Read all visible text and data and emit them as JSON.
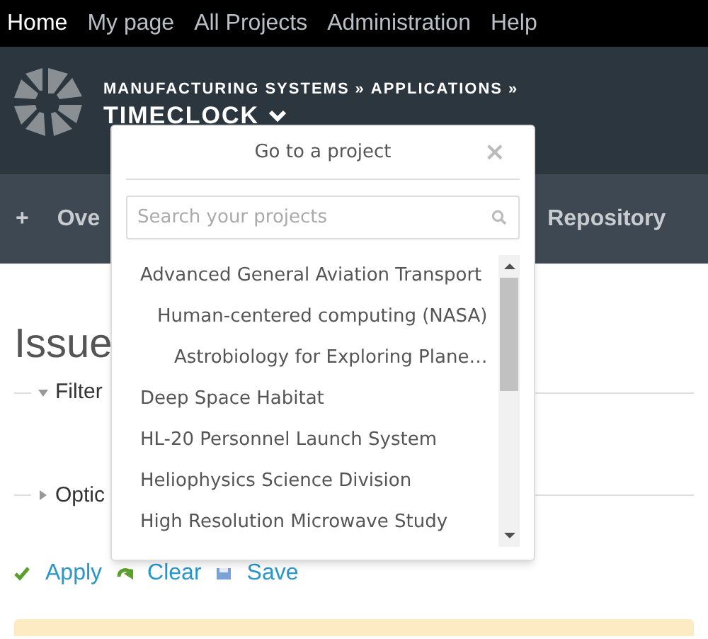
{
  "top_menu": [
    {
      "label": "Home",
      "selected": true
    },
    {
      "label": "My page",
      "selected": false
    },
    {
      "label": "All Projects",
      "selected": false
    },
    {
      "label": "Administration",
      "selected": false
    },
    {
      "label": "Help",
      "selected": false
    }
  ],
  "header": {
    "breadcrumb": [
      "MANUFACTURING SYSTEMS",
      "»",
      "APPLICATIONS",
      "»"
    ],
    "project": "TIMECLOCK"
  },
  "main_menu": [
    {
      "label": "+"
    },
    {
      "label": "Ove"
    },
    {
      "label": "Repository"
    }
  ],
  "content": {
    "title": "Issue",
    "fieldsets": [
      {
        "label": "Filter",
        "expanded": true
      },
      {
        "label": "Optic",
        "expanded": false
      }
    ],
    "actions": [
      "Apply",
      "Clear",
      "Save"
    ]
  },
  "project_jump": {
    "title": "Go to a project",
    "close": "×",
    "search": {
      "placeholder": "Search your projects"
    },
    "projects": [
      {
        "label": "Advanced General Aviation Transport",
        "children": [
          {
            "label": "Human-centered computing (NASA)",
            "children": [
              {
                "label": "Astrobiology for Exploring Plane…"
              }
            ]
          }
        ]
      },
      {
        "label": "Deep Space Habitat"
      },
      {
        "label": "HL-20 Personnel Launch System"
      },
      {
        "label": "Heliophysics Science Division"
      },
      {
        "label": "High Resolution Microwave Study"
      }
    ]
  }
}
